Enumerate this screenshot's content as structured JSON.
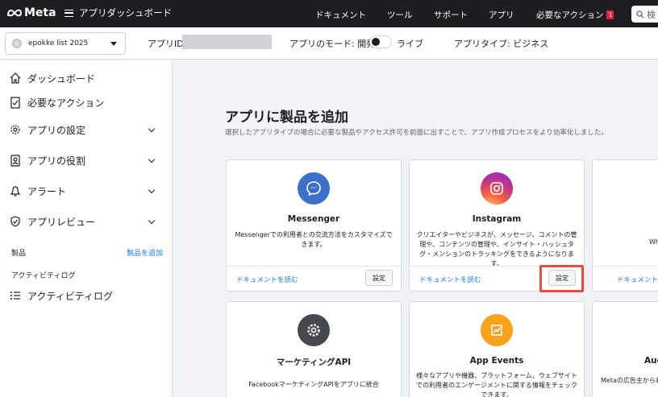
{
  "topbar": {
    "logo": "Meta",
    "menu_title": "アプリダッシュボード",
    "links": [
      "ドキュメント",
      "ツール",
      "サポート",
      "アプリ"
    ],
    "required_actions": "必要なアクション",
    "required_actions_count": "1",
    "search_placeholder": "検"
  },
  "subbar": {
    "app_name": "epokke list 2025",
    "app_id_label": "アプリID:",
    "mode_label": "アプリのモード: 開発",
    "live_label": "ライブ",
    "app_type_label": "アプリタイプ: ビジネス"
  },
  "sidebar": {
    "items": [
      {
        "label": "ダッシュボード",
        "icon": "home-icon"
      },
      {
        "label": "必要なアクション",
        "icon": "clipboard-icon"
      },
      {
        "label": "アプリの設定",
        "icon": "gear-icon"
      },
      {
        "label": "アプリの役割",
        "icon": "id-badge-icon"
      },
      {
        "label": "アラート",
        "icon": "bell-icon"
      },
      {
        "label": "アプリレビュー",
        "icon": "shield-check-icon"
      }
    ],
    "products_section": "製品",
    "add_product": "製品を追加",
    "activity_section": "アクティビティログ",
    "activity_item": "アクティビティログ"
  },
  "main": {
    "title": "アプリに製品を追加",
    "subtitle": "選択したアプリタイプの場合に必要な製品やアクセス許可を前面に出すことで、アプリ作成プロセスをより効率化しました。",
    "cards": [
      {
        "name": "Messenger",
        "desc": "Messengerでの利用者との交流方法をカスタマイズできます。",
        "doc": "ドキュメントを読む",
        "setup": "設定",
        "icon": "messenger-icon"
      },
      {
        "name": "Instagram",
        "desc": "クリエイターやビジネスが、メッセージ、コメントの管理や、コンテンツの管理や、インサイト・ハッシュタグ・メンションのトラッキングをできるようになります。",
        "doc": "ドキュメントを読む",
        "setup": "設定",
        "icon": "instagram-icon"
      },
      {
        "name": "",
        "desc": "Wh",
        "doc": "ドキュメントを読む",
        "setup": "",
        "icon": ""
      },
      {
        "name": "マーケティングAPI",
        "desc": "FacebookマーケティングAPIをアプリに統合",
        "icon": "gear-icon"
      },
      {
        "name": "App Events",
        "desc": "様々なアプリや機器、プラットフォーム、ウェブサイトでの利用者のエンゲージメントに関する情報をチェックできます。",
        "icon": "chart-icon"
      },
      {
        "name": "Aud",
        "desc": "Metaの広告主から収益を",
        "icon": ""
      }
    ]
  },
  "colors": {
    "accent": "#1877f2",
    "highlight": "#e74c3c",
    "messenger": "#1877f2",
    "app_events": "#f7a21b"
  }
}
